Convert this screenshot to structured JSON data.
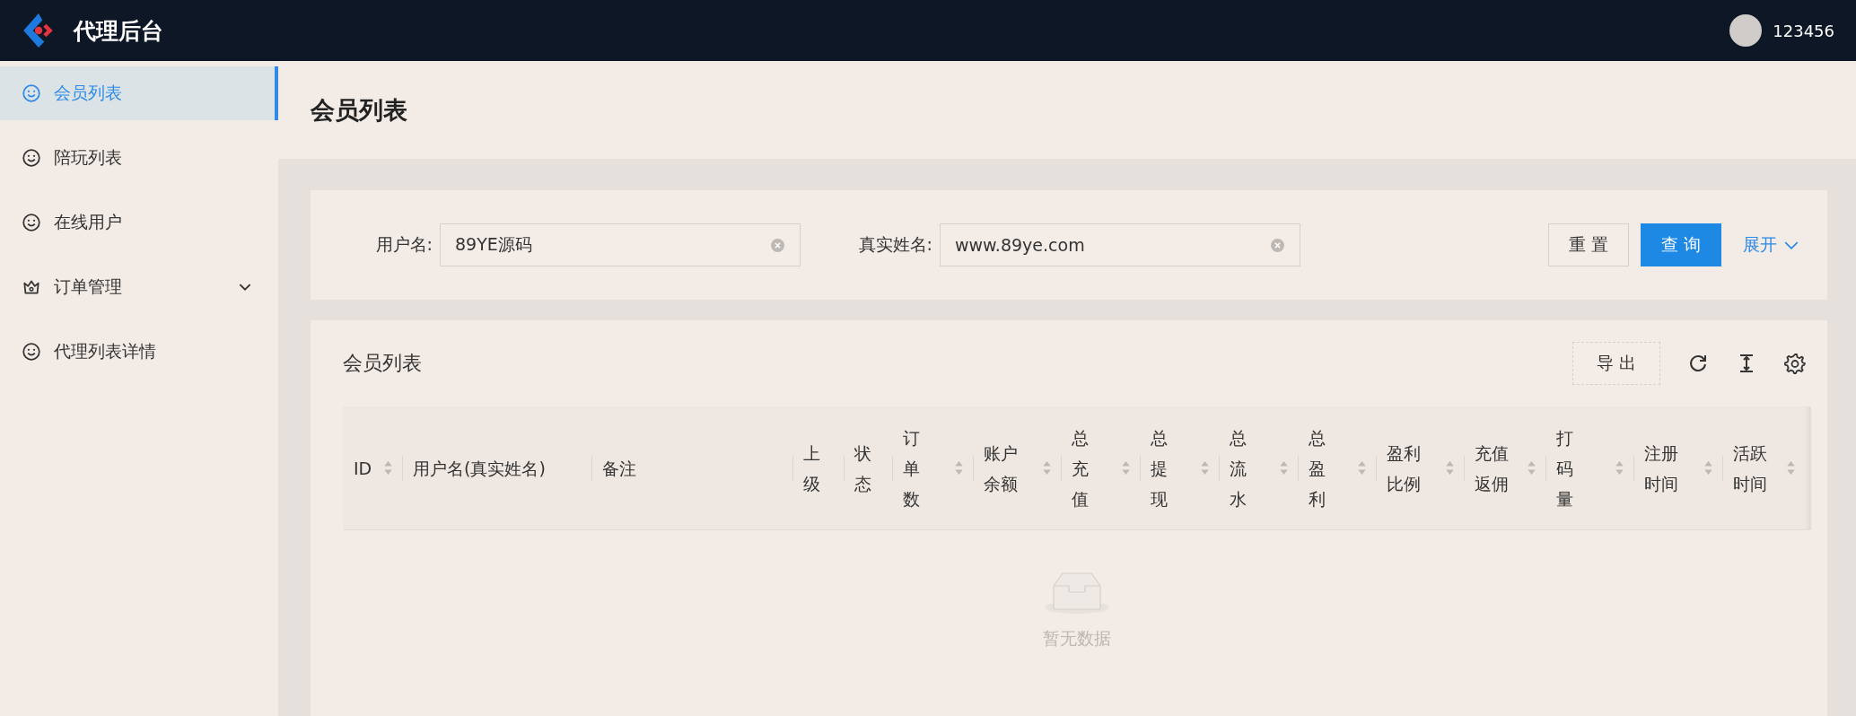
{
  "header": {
    "title": "代理后台",
    "user": "123456"
  },
  "sidebar": {
    "items": [
      {
        "label": "会员列表",
        "kind": "link",
        "selected": true
      },
      {
        "label": "陪玩列表",
        "kind": "link",
        "selected": false
      },
      {
        "label": "在线用户",
        "kind": "link",
        "selected": false
      },
      {
        "label": "订单管理",
        "kind": "submenu",
        "selected": false,
        "expanded": false
      },
      {
        "label": "代理列表详情",
        "kind": "link",
        "selected": false
      }
    ]
  },
  "page_title": "会员列表",
  "filters": [
    {
      "label": "用户名:",
      "value": "89YE源码"
    },
    {
      "label": "真实姓名:",
      "value": "www.89ye.com"
    }
  ],
  "filter_buttons": {
    "reset": "重 置",
    "search": "查 询",
    "expand": "展开"
  },
  "table": {
    "title": "会员列表",
    "export": "导 出",
    "columns": [
      {
        "label": "ID",
        "sortable": true
      },
      {
        "label": "用户名(真实姓名)",
        "sortable": false
      },
      {
        "label": "备注",
        "sortable": false
      },
      {
        "label": "上级",
        "sortable": false
      },
      {
        "label": "状态",
        "sortable": false
      },
      {
        "label": "订单数",
        "sortable": true
      },
      {
        "label": "账户余额",
        "sortable": true
      },
      {
        "label": "总充值",
        "sortable": true
      },
      {
        "label": "总提现",
        "sortable": true
      },
      {
        "label": "总流水",
        "sortable": true
      },
      {
        "label": "总盈利",
        "sortable": true
      },
      {
        "label": "盈利比例",
        "sortable": true
      },
      {
        "label": "充值返佣",
        "sortable": true
      },
      {
        "label": "打码量",
        "sortable": true
      },
      {
        "label": "注册时间",
        "sortable": true
      },
      {
        "label": "活跃时间",
        "sortable": true
      }
    ],
    "empty_text": "暂无数据"
  }
}
